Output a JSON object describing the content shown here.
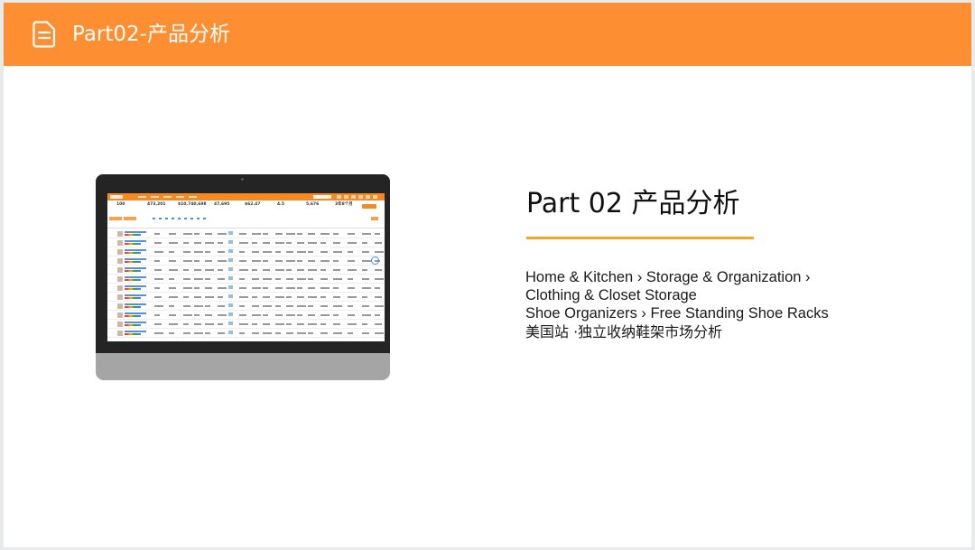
{
  "header": {
    "icon": "document-icon",
    "title": "Part02-产品分析"
  },
  "section": {
    "title": "Part 02  产品分析",
    "underline_color": "#f5a623"
  },
  "category_path": {
    "items": [
      "Home & Kitchen",
      "Storage & Organization",
      "Clothing & Closet Storage",
      "Shoe Organizers",
      "Free Standing Shoe Racks"
    ],
    "separator": "›"
  },
  "market_note": "美国站 ·独立收纳鞋架市场分析",
  "screen_stats": [
    {
      "value": "100",
      "label": "商品数"
    },
    {
      "value": "473,201",
      "label": "月总销量"
    },
    {
      "value": "$10,740,698",
      "label": "月总销售额"
    },
    {
      "value": "47,695",
      "label": "平均月销量"
    },
    {
      "value": "$62.47",
      "label": "平均价格"
    },
    {
      "value": "4.5",
      "label": "平均星级"
    },
    {
      "value": "5,676",
      "label": "平均评分数"
    },
    {
      "value": "3年8个月",
      "label": "平均上架时间"
    }
  ],
  "colors": {
    "header_bg": "#fd8e31",
    "accent": "#f5a623",
    "monitor_frame": "#242424",
    "monitor_chin": "#a5a5a5"
  }
}
